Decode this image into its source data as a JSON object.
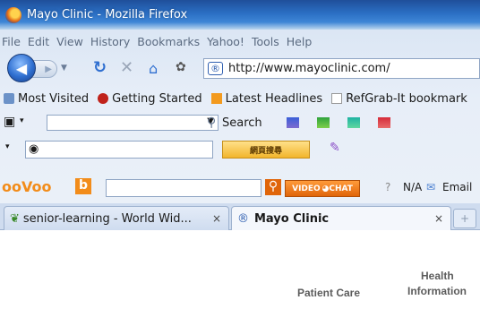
{
  "window": {
    "title": "Mayo Clinic - Mozilla Firefox"
  },
  "menu": [
    "File",
    "Edit",
    "View",
    "History",
    "Bookmarks",
    "Yahoo!",
    "Tools",
    "Help"
  ],
  "nav": {
    "url": "http://www.mayoclinic.com/",
    "favicon_text": "🖉"
  },
  "bookmarks": [
    "Most Visited",
    "Getting Started",
    "Latest Headlines",
    "RefGrab-It bookmark"
  ],
  "toolbar1": {
    "search_label": "Search"
  },
  "toolbar2": {
    "google_button": "網頁搜尋"
  },
  "toolbar3": {
    "video_chat": "VIDEO ◕CHAT",
    "na": "N/A",
    "email": "Email"
  },
  "tabs": [
    {
      "label": "senior-learning - World Wid...",
      "close": "×"
    },
    {
      "label": "Mayo Clinic",
      "close": "×"
    }
  ],
  "newtab": "+",
  "page": {
    "links": [
      "Patient Care",
      "Health",
      "Information"
    ]
  },
  "colors": {
    "titlebar": "#2b6fc4",
    "menu_text": "#5a6a80"
  }
}
